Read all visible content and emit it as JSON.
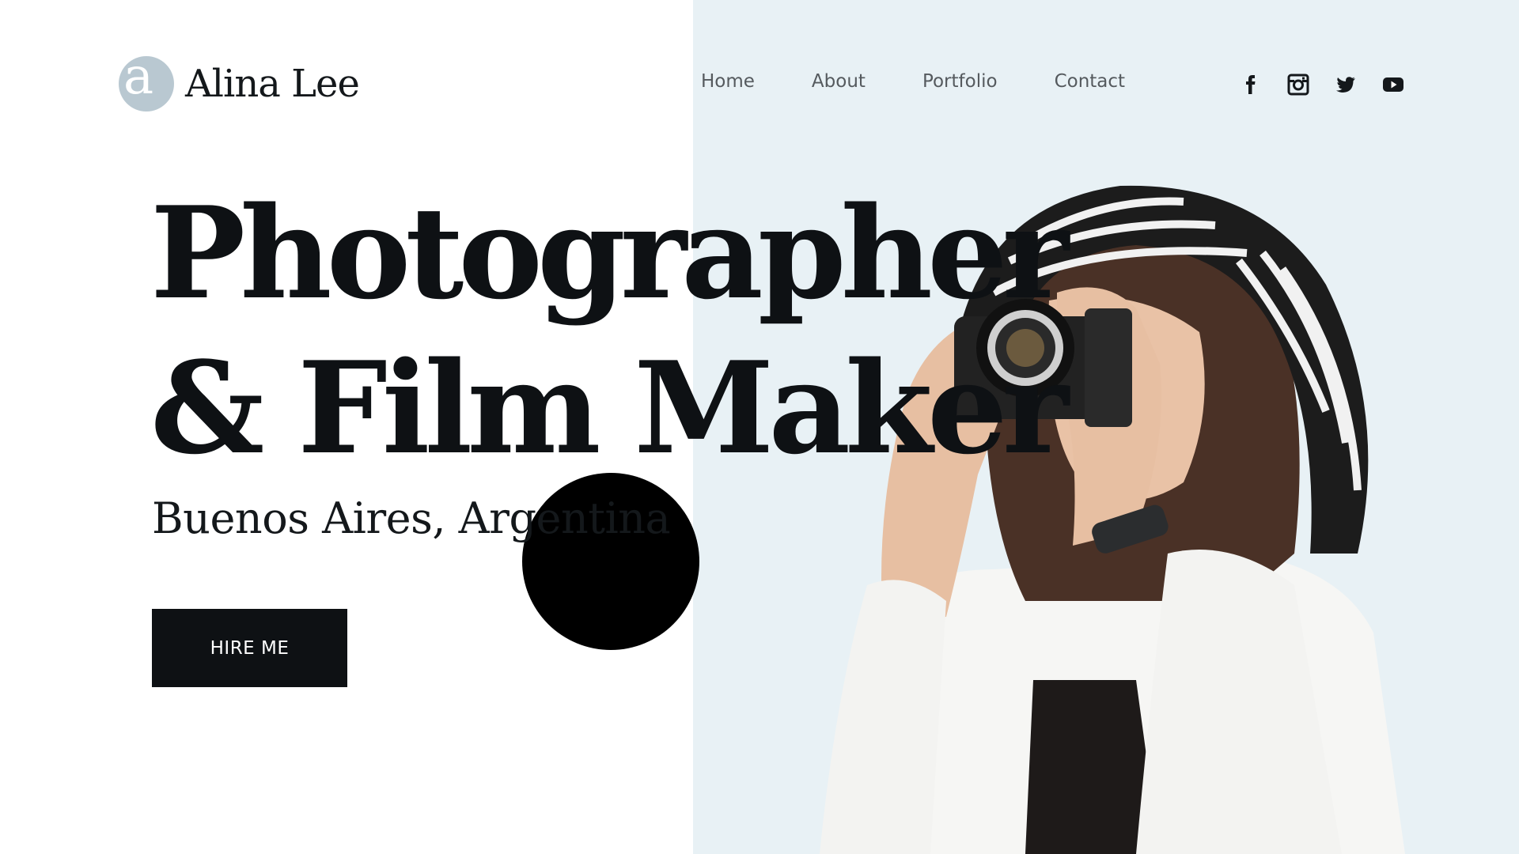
{
  "brand": {
    "logo_letter": "a",
    "name": "Alina Lee"
  },
  "nav": {
    "items": [
      "Home",
      "About",
      "Portfolio",
      "Contact"
    ]
  },
  "social": {
    "icons": [
      "facebook-icon",
      "instagram-icon",
      "twitter-icon",
      "youtube-icon"
    ]
  },
  "hero": {
    "headline_line1": "Photographer",
    "headline_line2": "& Film Maker",
    "location": "Buenos Aires, Argentina",
    "cta_label": "HIRE ME"
  },
  "colors": {
    "background": "#ffffff",
    "panel": "#e8f1f5",
    "ink": "#0e1114",
    "logo_mark": "#b9c8d1"
  }
}
